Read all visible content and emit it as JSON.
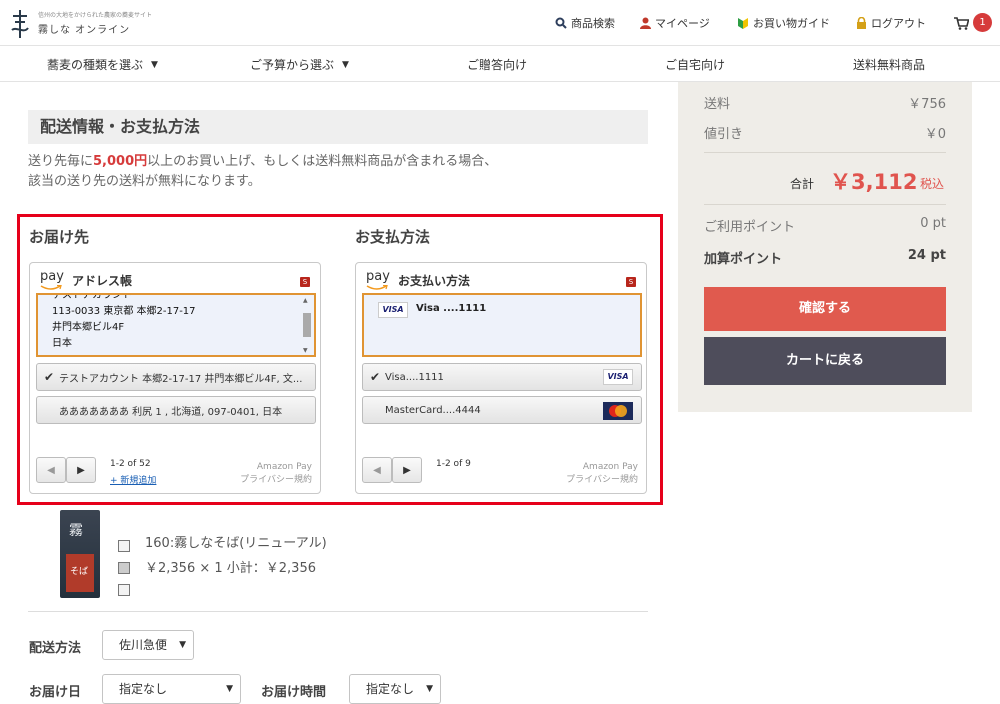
{
  "header": {
    "logo_tag": "信州の大地をかけられた農家の蕎麦サイト",
    "logo_name": "霧しな オンライン",
    "nav": {
      "search": "商品検索",
      "mypage": "マイページ",
      "guide": "お買い物ガイド",
      "logout": "ログアウト"
    },
    "cart_count": "1"
  },
  "catnav": {
    "items": [
      "蕎麦の種類を選ぶ",
      "ご予算から選ぶ",
      "ご贈答向け",
      "ご自宅向け",
      "送料無料商品"
    ]
  },
  "summary": {
    "shipping_label": "送料",
    "shipping_value": "￥756",
    "discount_label": "値引き",
    "discount_value": "￥0",
    "total_label": "合計",
    "total_amount": "￥3,112",
    "total_tax": "税込",
    "used_points_label": "ご利用ポイント",
    "used_points_value": "0 pt",
    "added_points_label": "加算ポイント",
    "added_points_value": "24 pt",
    "confirm_button": "確認する",
    "back_button": "カートに戻る"
  },
  "main": {
    "section_title": "配送情報・お支払方法",
    "notice_line1_pre": "送り先毎に",
    "notice_line1_highlight": "5,000円",
    "notice_line1_post": "以上のお買い上げ、もしくは送料無料商品が含まれる場合、",
    "notice_line2": "該当の送り先の送料が無料になります。"
  },
  "delivery": {
    "heading": "お届け先",
    "widget_title": "アドレス帳",
    "pay_word": "pay",
    "s_badge": "S",
    "selected_address": [
      "テストアカウント",
      "113-0033 東京都 本郷2-17-17",
      "井門本郷ビル4F",
      "日本"
    ],
    "options": [
      {
        "check": "✔",
        "text": "テストアカウント 本郷2-17-17 井門本郷ビル4F, 文..."
      },
      {
        "check": "",
        "text": "あああああああ 利尻 1 , 北海道, 097-0401, 日本"
      }
    ],
    "pager_info": "1-2 of 52",
    "add_new": "+ 新規追加",
    "amazon_pay": "Amazon Pay",
    "privacy": "プライバシー規約"
  },
  "payment": {
    "heading": "お支払方法",
    "widget_title": "お支払い方法",
    "pay_word": "pay",
    "s_badge": "S",
    "selected_card": "Visa ....1111",
    "selected_card_brand": "VISA",
    "options": [
      {
        "check": "✔",
        "text": "Visa....1111",
        "brand": "VISA"
      },
      {
        "check": "",
        "text": "MasterCard....4444",
        "brand": "MasterCard"
      }
    ],
    "pager_info": "1-2 of 9",
    "amazon_pay": "Amazon Pay",
    "privacy": "プライバシー規約"
  },
  "product": {
    "name": "160:霧しなそば(リニューアル)",
    "price_line": "￥2,356 × 1  小計：￥2,356",
    "package_label": "そば"
  },
  "form": {
    "shipping_method_label": "配送方法",
    "shipping_method_value": "佐川急便",
    "delivery_date_label": "お届け日",
    "delivery_date_value": "指定なし",
    "delivery_time_label": "お届け時間",
    "delivery_time_value": "指定なし"
  },
  "colors": {
    "accent_red": "#e05a4e",
    "price_red": "#e0544e",
    "dark_button": "#4e4d5b",
    "highlight_frame": "#e6001a",
    "amazon_orange": "#e09433",
    "sidebar_bg": "#efede8"
  }
}
